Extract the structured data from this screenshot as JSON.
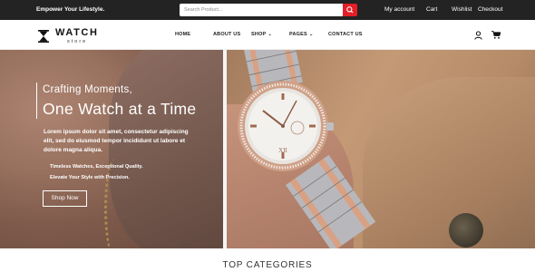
{
  "topbar": {
    "tagline": "Empower Your Lifestyle.",
    "search_placeholder": "Search Product...",
    "links": [
      "My account",
      "Cart",
      "Wishlist",
      "Checkout"
    ]
  },
  "logo": {
    "name": "WATCH",
    "sub": "store"
  },
  "nav": {
    "items": [
      "HOME",
      "ABOUT US",
      "SHOP",
      "PAGES",
      "CONTACT US"
    ],
    "dropdown_chevron": "⌄"
  },
  "hero": {
    "subtitle": "Crafting Moments,",
    "title": "One Watch at a Time",
    "body": "Lorem ipsum dolor sit amet, consectetur adipiscing elit, sed do eiusmod tempor incididunt ut labore et dolore magna aliqua.",
    "line1": "Timeless Watches, Exceptional Quality.",
    "line2": "Elevate Your Style with Precision.",
    "cta": "Shop Now"
  },
  "section": {
    "title": "TOP CATEGORIES"
  },
  "colors": {
    "topbar": "#232323",
    "accent": "#e41e26"
  },
  "icons": [
    "search-icon",
    "hourglass-logo-icon",
    "user-icon",
    "cart-icon",
    "chevron-down-icon"
  ]
}
